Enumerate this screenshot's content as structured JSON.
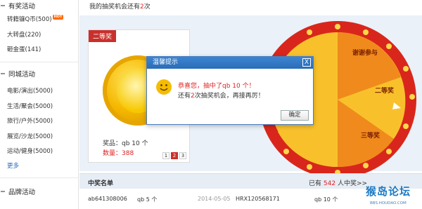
{
  "sidebar": {
    "section1": "有奖活动",
    "items1": [
      {
        "label": "转籍镰Q币(500)",
        "hot": "HOT"
      },
      {
        "label": "大转盘(220)"
      },
      {
        "label": "砸金蛋(141)"
      }
    ],
    "section2": "同城活动",
    "items2": [
      {
        "label": "电影/演出(5000)"
      },
      {
        "label": "生活/聚会(5000)"
      },
      {
        "label": "旅行/户外(5000)"
      },
      {
        "label": "展览/沙龙(5000)"
      },
      {
        "label": "运动/健身(5000)"
      }
    ],
    "more": "更多",
    "section3": "品牌活动"
  },
  "main": {
    "chance_prefix": "我的抽奖机会还有",
    "chance_count": "2",
    "chance_suffix": "次",
    "card": {
      "tag": "二等奖",
      "prize": "奖品：qb 10 个",
      "quantity": "数量：388",
      "pages": [
        "1",
        "2",
        "3"
      ],
      "active_page": "2"
    },
    "wheel": {
      "segment_top": "谢谢参与",
      "segment_right": "二等奖",
      "segment_bottom": "三等奖",
      "colors": {
        "rim": "#d9261c",
        "yellow": "#f8c12c",
        "orange": "#f08a1c",
        "stud": "#ffd84a"
      }
    },
    "winners": {
      "title": "中奖名单",
      "count_prefix": "已有",
      "count": "542",
      "count_suffix": "人中奖>>",
      "rows": [
        {
          "user": "ab641308006",
          "prize": "qb 5 个",
          "date": "2014-05-05",
          "user2": "HRX120568171",
          "prize2": "qb 10 个"
        }
      ]
    }
  },
  "dialog": {
    "title": "温馨提示",
    "close": "X",
    "line1": "恭喜您，抽中了qb 10 个！",
    "line2_prefix": "还有",
    "line2_count": "2",
    "line2_suffix": "次抽奖机会，再接再厉！",
    "ok": "确定"
  },
  "watermark": {
    "text": "猴岛论坛",
    "sub": "BBS.HOUDAO.COM"
  },
  "colors": {
    "accent_red": "#e02020",
    "dialog_blue": "#2a6cb8",
    "link_blue": "#2a6bb5"
  }
}
